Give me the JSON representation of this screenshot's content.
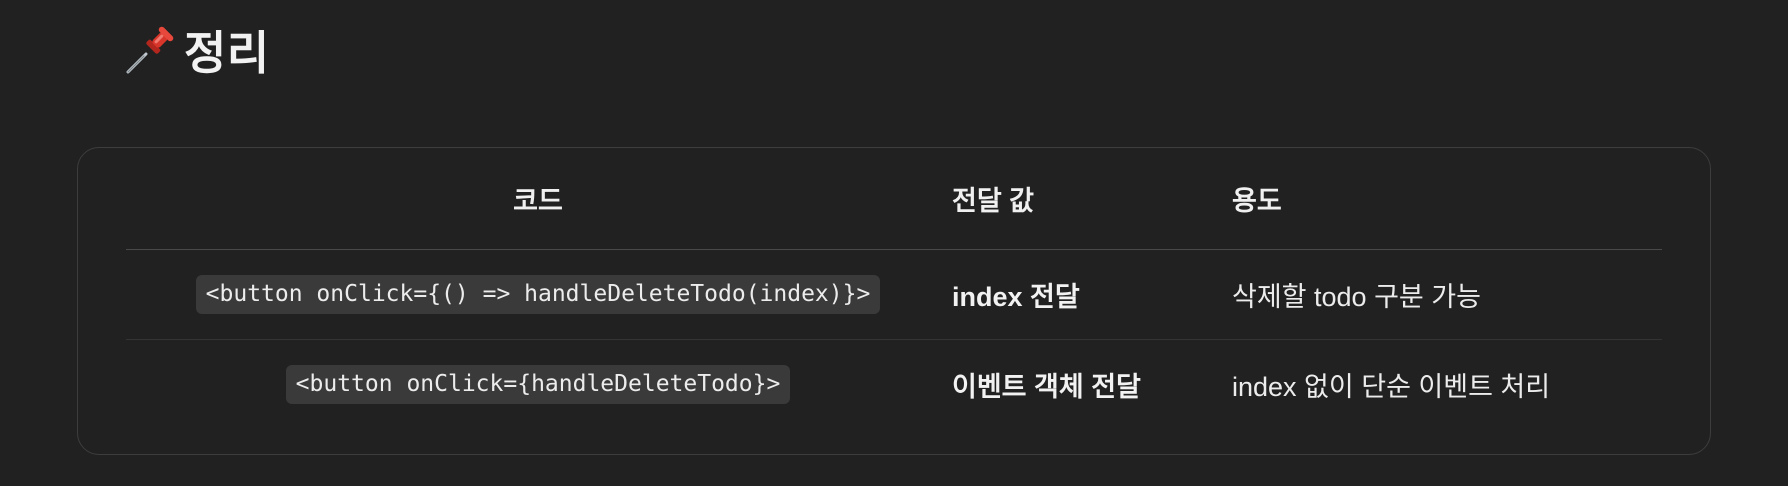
{
  "section": {
    "icon": "pushpin-icon",
    "title": "정리"
  },
  "table": {
    "headers": {
      "code": "코드",
      "value": "전달 값",
      "usage": "용도"
    },
    "rows": [
      {
        "code": "<button onClick={() => handleDeleteTodo(index)}>",
        "value": "index 전달",
        "usage": "삭제할 todo 구분 가능"
      },
      {
        "code": "<button onClick={handleDeleteTodo}>",
        "value": "이벤트 객체 전달",
        "usage": "index 없이 단순 이벤트 처리"
      }
    ]
  },
  "colors": {
    "background": "#212121",
    "code_background": "#3a3a3a",
    "border": "#3d3d3d",
    "pin_red": "#d9362b"
  }
}
